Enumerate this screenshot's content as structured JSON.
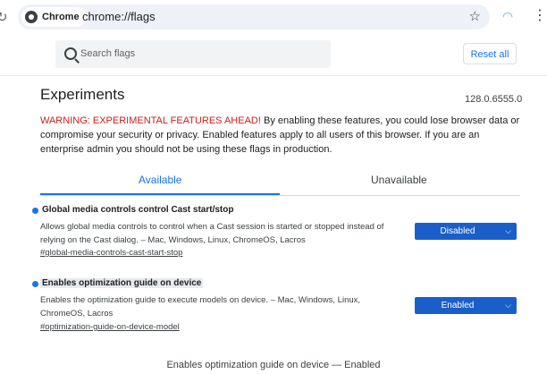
{
  "browser": {
    "chip_label": "Chrome",
    "url": "chrome://flags"
  },
  "header": {
    "search_placeholder": "Search flags",
    "reset_label": "Reset all"
  },
  "page": {
    "title": "Experiments",
    "version": "128.0.6555.0",
    "warning_red": "WARNING: EXPERIMENTAL FEATURES AHEAD!",
    "warning_body": " By enabling these features, you could lose browser data or compromise your security or privacy. Enabled features apply to all users of this browser. If you are an enterprise admin you should not be using these flags in production."
  },
  "tabs": [
    {
      "label": "Available",
      "active": true
    },
    {
      "label": "Unavailable",
      "active": false
    }
  ],
  "flags": [
    {
      "name": "Global media controls control Cast start/stop",
      "description": "Allows global media controls to control when a Cast session is started or stopped instead of relying on the Cast dialog. – Mac, Windows, Linux, ChromeOS, Lacros",
      "link": "#global-media-controls-cast-start-stop",
      "value": "Disabled"
    },
    {
      "name": "Enables optimization guide on device",
      "description": "Enables the optimization guide to execute models on device. – Mac, Windows, Linux, ChromeOS, Lacros",
      "link": "#optimization-guide-on-device-model",
      "value": "Enabled"
    }
  ],
  "footer": {
    "caption": "Enables optimization guide on device — Enabled"
  },
  "colors": {
    "accent": "#1a73e8",
    "select_bg": "#1a5fc9",
    "warning": "#c5221f"
  }
}
